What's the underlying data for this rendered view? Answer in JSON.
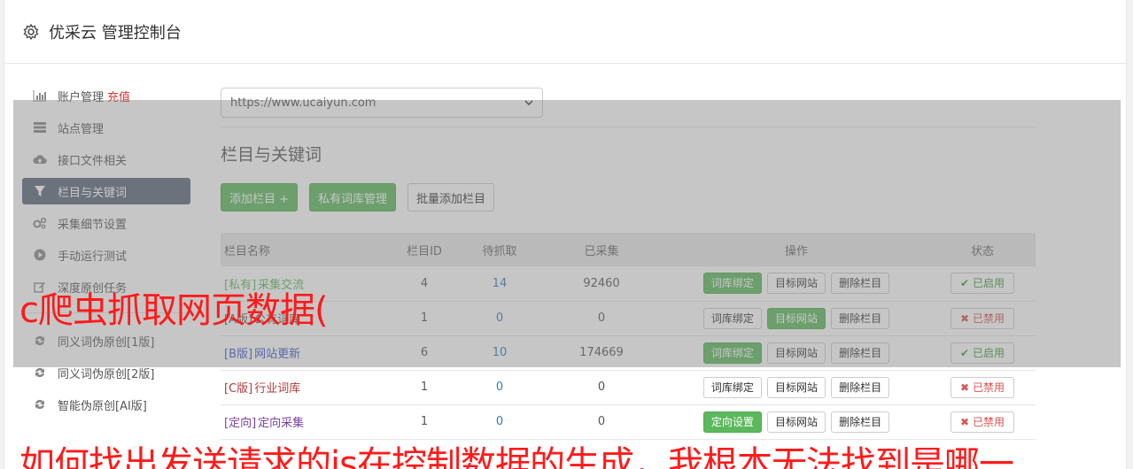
{
  "header": {
    "title": "优采云 管理控制台"
  },
  "sidebar": {
    "items": [
      {
        "label": "账户管理",
        "icon": "bar-chart-icon",
        "extra": "充值"
      },
      {
        "label": "站点管理",
        "icon": "server-icon"
      },
      {
        "label": "接口文件相关",
        "icon": "cloud-upload-icon"
      },
      {
        "label": "栏目与关键词",
        "icon": "filter-icon",
        "active": true
      },
      {
        "label": "采集细节设置",
        "icon": "cogs-icon"
      },
      {
        "label": "手动运行测试",
        "icon": "play-circle-icon"
      },
      {
        "label": "深度原创任务",
        "icon": "edit-icon"
      }
    ],
    "items2": [
      {
        "label": "同义词伪原创[1版]",
        "icon": "refresh-icon"
      },
      {
        "label": "同义词伪原创[2版]",
        "icon": "refresh-icon"
      },
      {
        "label": "智能伪原创[AI版]",
        "icon": "refresh-icon"
      }
    ]
  },
  "main": {
    "site_select": "https://www.ucaiyun.com",
    "section_title": "栏目与关键词",
    "buttons": {
      "add": "添加栏目 +",
      "private_lib": "私有词库管理",
      "batch_add": "批量添加栏目"
    },
    "table": {
      "headers": [
        "栏目名称",
        "栏目ID",
        "待抓取",
        "已采集",
        "操作",
        "状态"
      ],
      "ops": {
        "bind": "词库绑定",
        "target": "目标网站",
        "delete": "删除栏目",
        "direct": "定向设置"
      },
      "rows": [
        {
          "tag": "[私有]",
          "name": "采集交流",
          "id": "4",
          "pending": "14",
          "collected": "92460",
          "status": "已启用"
        },
        {
          "tag": "[A版]",
          "name": "公有词库",
          "id": "1",
          "pending": "0",
          "collected": "0",
          "status": "已禁用"
        },
        {
          "tag": "[B版]",
          "name": "网站更新",
          "id": "6",
          "pending": "10",
          "collected": "174669",
          "status": "已启用"
        },
        {
          "tag": "[C版]",
          "name": "行业词库",
          "id": "1",
          "pending": "0",
          "collected": "0",
          "status": "已禁用"
        },
        {
          "tag": "[定向]",
          "name": "定向采集",
          "id": "1",
          "pending": "0",
          "collected": "0",
          "status": "已禁用"
        }
      ]
    }
  },
  "watermark": {
    "line1": "c爬虫抓取网页数据(",
    "line2": "如何找出发送请求的js在控制数据的生成，我根本无法找到是哪一"
  },
  "colors": {
    "accent_green": "#5cb85c",
    "active_sidebar": "#5a6678",
    "danger": "#d9534f",
    "watermark": "#ff1a1a"
  }
}
